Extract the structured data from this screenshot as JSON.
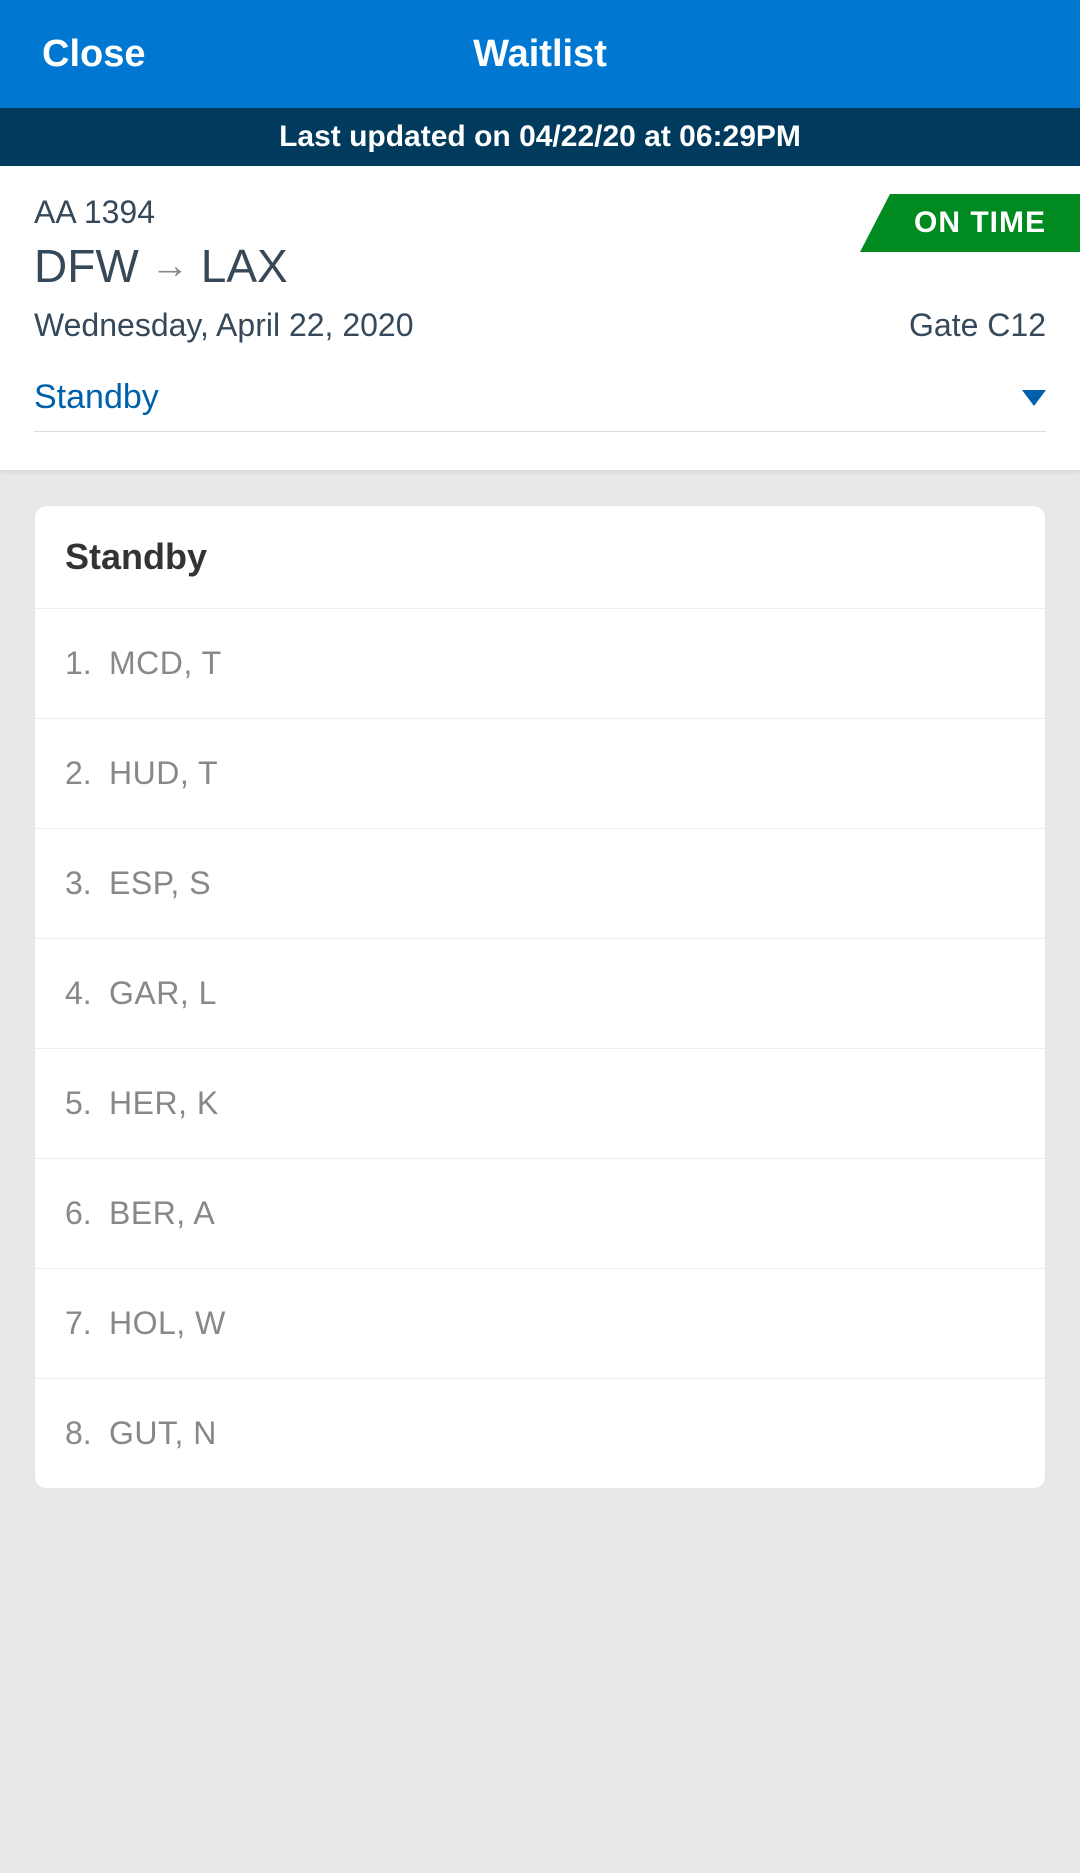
{
  "header": {
    "close_label": "Close",
    "title": "Waitlist"
  },
  "updated_text": "Last updated on 04/22/20 at 06:29PM",
  "flight": {
    "number": "AA 1394",
    "origin": "DFW",
    "destination": "LAX",
    "date": "Wednesday, April 22, 2020",
    "gate": "Gate C12",
    "status": "ON TIME"
  },
  "dropdown": {
    "selected": "Standby"
  },
  "list": {
    "title": "Standby",
    "items": [
      {
        "pos": "1.",
        "name": "MCD, T"
      },
      {
        "pos": "2.",
        "name": "HUD, T"
      },
      {
        "pos": "3.",
        "name": "ESP, S"
      },
      {
        "pos": "4.",
        "name": "GAR, L"
      },
      {
        "pos": "5.",
        "name": "HER, K"
      },
      {
        "pos": "6.",
        "name": "BER, A"
      },
      {
        "pos": "7.",
        "name": "HOL, W"
      },
      {
        "pos": "8.",
        "name": "GUT, N"
      }
    ]
  }
}
